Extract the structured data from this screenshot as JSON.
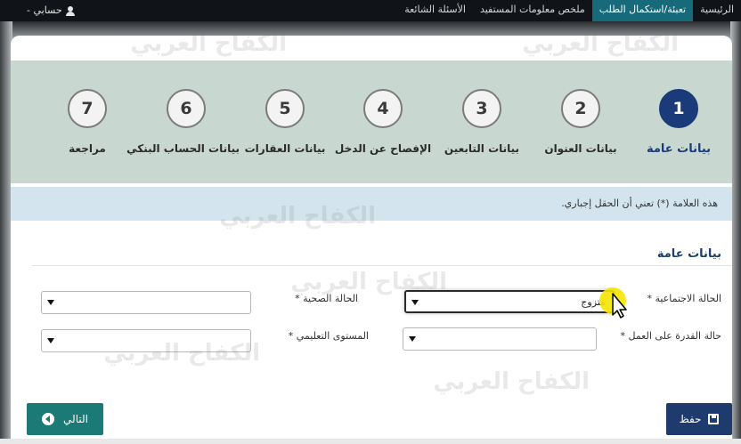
{
  "nav": {
    "items": [
      {
        "label": "الرئيسية",
        "active": false
      },
      {
        "label": "تعبئة/استكمال الطلب",
        "active": true
      },
      {
        "label": "ملخص معلومات المستفيد",
        "active": false
      },
      {
        "label": "الأسئلة الشائعة",
        "active": false
      }
    ],
    "account_label": "حسابي -"
  },
  "wizard": {
    "steps": [
      {
        "number": "1",
        "label": "بيانات عامة",
        "active": true
      },
      {
        "number": "2",
        "label": "بيانات العنوان",
        "active": false
      },
      {
        "number": "3",
        "label": "بيانات التابعين",
        "active": false
      },
      {
        "number": "4",
        "label": "الإفصاح عن الدخل",
        "active": false
      },
      {
        "number": "5",
        "label": "بيانات العقارات",
        "active": false
      },
      {
        "number": "6",
        "label": "بيانات الحساب البنكي",
        "active": false
      },
      {
        "number": "7",
        "label": "مراجعة",
        "active": false
      }
    ]
  },
  "note": "هذه العلامة (*) تعني أن الحقل إجباري.",
  "section": {
    "title": "بيانات عامة"
  },
  "fields": {
    "marital_status": {
      "label": "الحالة الاجتماعية *",
      "value": "متزوج"
    },
    "health_status": {
      "label": "الحالة الصحية *",
      "value": ""
    },
    "work_ability": {
      "label": "حالة القدرة على العمل *",
      "value": ""
    },
    "education_level": {
      "label": "المستوى التعليمي *",
      "value": ""
    }
  },
  "buttons": {
    "save": "حفظ",
    "next": "التالي"
  },
  "watermark": "الكفاح العربي",
  "colors": {
    "topbar": "#101418",
    "nav_active": "#166a7a",
    "wizard_bg": "#c8d7cf",
    "step_active": "#1b3a7a",
    "note_bg": "#d3e4ee",
    "save_button": "#1f3a6c",
    "next_button": "#1c7a76"
  },
  "icons": {
    "account": "user-icon",
    "save": "save-icon",
    "next": "arrow-circle-left-icon",
    "dropdown": "caret-down-icon",
    "cursor": "mouse-pointer-icon"
  }
}
